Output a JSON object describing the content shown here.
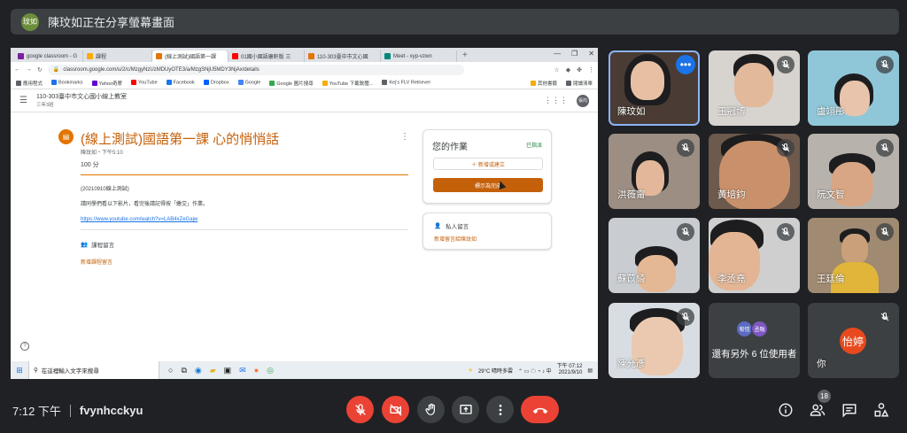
{
  "banner": {
    "avatar_text": "玟如",
    "text": "陳玟如正在分享螢幕畫面"
  },
  "browser": {
    "tabs": [
      {
        "label": "google classroom - G",
        "color": "#7b1fa2"
      },
      {
        "label": "課程",
        "color": "#f9ab00"
      },
      {
        "label": "(線上測試)國語第一課",
        "color": "#e37400"
      },
      {
        "label": "01國小國語康軒版 三",
        "color": "#ff0000"
      },
      {
        "label": "110-303臺中市文心國",
        "color": "#e37400"
      },
      {
        "label": "Meet - xyp-vzwn",
        "color": "#00897b"
      }
    ],
    "url": "classroom.google.com/u/2/c/MzgyNzUzMDUyOTE3/a/MzgSNjU5MDY3NjAx/details",
    "bookmarks": [
      {
        "label": "應用程式",
        "color": "#5f6368"
      },
      {
        "label": "Bookmarks",
        "color": "#1a73e8"
      },
      {
        "label": "Yahoo奇摩",
        "color": "#6001d2"
      },
      {
        "label": "YouTube",
        "color": "#ff0000"
      },
      {
        "label": "Facebook",
        "color": "#1877f2"
      },
      {
        "label": "Dropbox",
        "color": "#0061ff"
      },
      {
        "label": "Google",
        "color": "#4285f4"
      },
      {
        "label": "Google 圖片搜尋",
        "color": "#34a853"
      },
      {
        "label": "YouTube 下載軟體...",
        "color": "#f9ab00"
      },
      {
        "label": "Kej's FLV Retriever",
        "color": "#5f6368"
      }
    ],
    "bookmarks_right": [
      "其他書籤",
      "閱讀清單"
    ]
  },
  "classroom": {
    "class_title": "110-303臺中市文心國小線上教室",
    "class_sub": "三年3班",
    "profile": "張均",
    "assignment_title": "(線上測試)國語第一課 心的悄悄話",
    "meta": "陳玟如・下午5:10",
    "points": "100 分",
    "date": "(20210910線上測試)",
    "body": "請同學們看以下影片，看完後請記得按「繳交」作業。",
    "link": "https://www.youtube.com/watch?v=LAB4xZeGajw",
    "class_comments": "課程留言",
    "add_class_comment": "新增課程留言",
    "work_title": "您的作業",
    "work_status": "已指派",
    "add_or_create": "＋ 新增或建立",
    "mark_done": "標示為完成",
    "private_comments": "私人留言",
    "add_private": "新增留言給陳玟如"
  },
  "taskbar": {
    "search": "在這裡輸入文字來搜尋",
    "weather": "29°C 晴時多雲",
    "time": "下午 07:12",
    "date": "2021/9/10"
  },
  "participants": [
    {
      "name": "陳玟如",
      "bg": "#4a3c34",
      "face": "#e7c0a3",
      "speaking": true
    },
    {
      "name": "王冠博",
      "bg": "#d7d3cf",
      "face": "#e2b99b",
      "speaking": false
    },
    {
      "name": "盧翊彤",
      "bg": "#8fc7d9",
      "face": "#e8c4ad",
      "speaking": false
    },
    {
      "name": "洪薇甯",
      "bg": "#9c8e83",
      "face": "#e3b89a",
      "speaking": false
    },
    {
      "name": "黃培鈞",
      "bg": "#6d5a4d",
      "face": "#c9916b",
      "speaking": false
    },
    {
      "name": "阮文智",
      "bg": "#b7b3ac",
      "face": "#d8a684",
      "speaking": false
    },
    {
      "name": "蘇苡綺",
      "bg": "#c9cdd1",
      "face": "#e4b895",
      "speaking": false
    },
    {
      "name": "李丞堯",
      "bg": "#cfcfcf",
      "face": "#e3b594",
      "speaking": false
    },
    {
      "name": "王廷倫",
      "bg": "#a08a71",
      "face": "#caa07a",
      "speaking": false
    },
    {
      "name": "陳允彥",
      "bg": "#d8dde3",
      "face": "#eac9b0",
      "speaking": false
    }
  ],
  "others": {
    "avatars": [
      "宥愷",
      "丞融"
    ],
    "avatar_colors": [
      "#5c6bc0",
      "#7e57c2"
    ],
    "label": "還有另外 6 位使用者"
  },
  "self": {
    "avatar": "怡婷",
    "name": "你"
  },
  "bottom": {
    "time": "7:12 下午",
    "meeting_code": "fvynhcckyu",
    "participant_count": "18"
  }
}
